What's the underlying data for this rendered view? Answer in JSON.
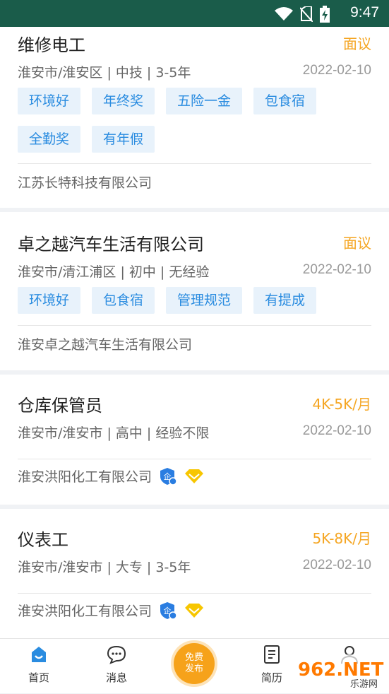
{
  "status_bar": {
    "time": "9:47"
  },
  "jobs": [
    {
      "title": "维修电工",
      "salary": "面议",
      "meta": "淮安市/淮安区 | 中技 | 3-5年",
      "date": "2022-02-10",
      "tags": [
        "环境好",
        "年终奖",
        "五险一金",
        "包食宿",
        "全勤奖",
        "有年假"
      ],
      "company": "江苏长特科技有限公司",
      "verified": false
    },
    {
      "title": "卓之越汽车生活有限公司",
      "salary": "面议",
      "meta": "淮安市/清江浦区 | 初中 | 无经验",
      "date": "2022-02-10",
      "tags": [
        "环境好",
        "包食宿",
        "管理规范",
        "有提成"
      ],
      "company": "淮安卓之越汽车生活有限公司",
      "verified": false
    },
    {
      "title": "仓库保管员",
      "salary": "4K-5K/月",
      "meta": "淮安市/淮安市 | 高中 | 经验不限",
      "date": "2022-02-10",
      "tags": [],
      "company": "淮安洪阳化工有限公司",
      "verified": true
    },
    {
      "title": "仪表工",
      "salary": "5K-8K/月",
      "meta": "淮安市/淮安市 | 大专 | 3-5年",
      "date": "2022-02-10",
      "tags": [],
      "company": "淮安洪阳化工有限公司",
      "verified": true
    }
  ],
  "bottom_nav": {
    "home": "首页",
    "messages": "消息",
    "publish_line1": "免费",
    "publish_line2": "发布",
    "resume": "简历"
  },
  "watermark": {
    "text": "962.NET",
    "subtext": "乐游网"
  },
  "colors": {
    "header": "#1a5c4a",
    "salary": "#f5a623",
    "tag_bg": "#e8f2fb",
    "tag_text": "#2a8ce0",
    "publish": "#f6a21a"
  }
}
